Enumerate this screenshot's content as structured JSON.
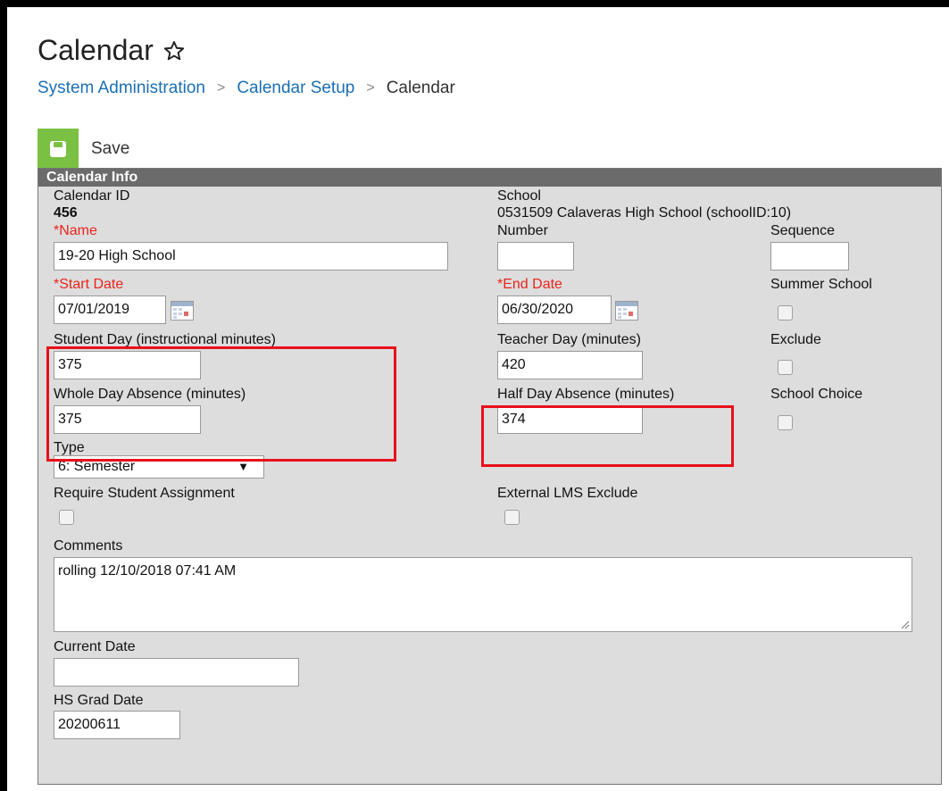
{
  "page": {
    "title": "Calendar",
    "breadcrumb": [
      "System Administration",
      "Calendar Setup",
      "Calendar"
    ]
  },
  "toolbar": {
    "save_label": "Save"
  },
  "panel": {
    "header": "Calendar Info",
    "calendar_id_label": "Calendar ID",
    "calendar_id": "456",
    "school_label": "School",
    "school_value": "0531509 Calaveras High School (schoolID:10)",
    "name_label": "*Name",
    "name_value": "19-20 High School",
    "number_label": "Number",
    "number_value": "",
    "sequence_label": "Sequence",
    "sequence_value": "",
    "start_date_label": "*Start Date",
    "start_date_value": "07/01/2019",
    "end_date_label": "*End Date",
    "end_date_value": "06/30/2020",
    "summer_school_label": "Summer School",
    "student_day_label": "Student Day (instructional minutes)",
    "student_day_value": "375",
    "teacher_day_label": "Teacher Day (minutes)",
    "teacher_day_value": "420",
    "exclude_label": "Exclude",
    "whole_day_label": "Whole Day Absence (minutes)",
    "whole_day_value": "375",
    "half_day_label": "Half Day Absence (minutes)",
    "half_day_value": "374",
    "school_choice_label": "School Choice",
    "type_label": "Type",
    "type_value": "6: Semester",
    "require_student_label": "Require Student Assignment",
    "external_lms_label": "External LMS Exclude",
    "comments_label": "Comments",
    "comments_value": "rolling 12/10/2018 07:41 AM",
    "current_date_label": "Current Date",
    "current_date_value": "",
    "hs_grad_label": "HS Grad Date",
    "hs_grad_value": "20200611"
  },
  "colors": {
    "link": "#1a6fb3",
    "required": "#e8241c",
    "save_green": "#7ac143",
    "highlight_red": "#e8101a",
    "panel_header": "#6b6b6b"
  },
  "icons": [
    "star-outline-icon",
    "save-icon",
    "calendar-icon",
    "chevron-right-icon",
    "resize-grip-icon"
  ]
}
